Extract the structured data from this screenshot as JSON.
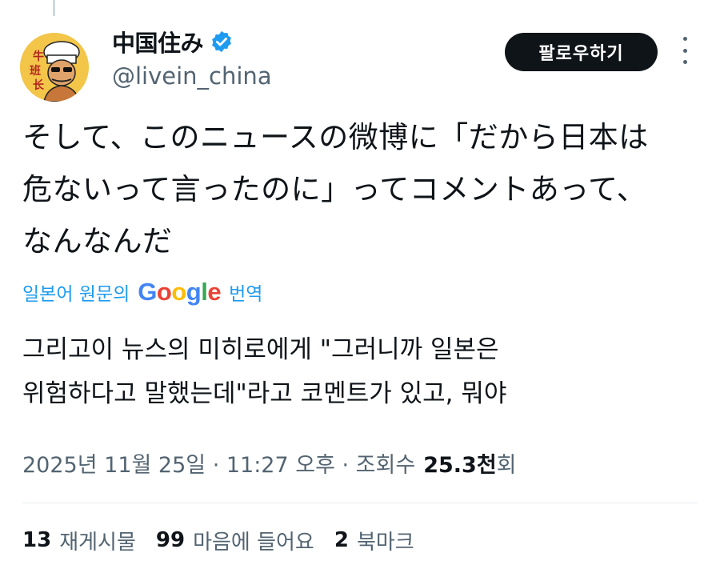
{
  "author": {
    "display_name": "中国住み",
    "handle": "@livein_china",
    "verified": true,
    "avatar_text": "牛班长"
  },
  "follow_label": "팔로우하기",
  "tweet_text": "そして、このニュースの微博に「だから日本は\n危ないって言ったのに」ってコメントあって、\nなんなんだ",
  "translation": {
    "label_prefix": "일본어 원문의",
    "label_suffix": "번역",
    "provider": "Google",
    "text": "그리고이 뉴스의 미히로에게 \"그러니까 일본은\n위험하다고 말했는데\"라고 코멘트가 있고, 뭐야"
  },
  "meta": {
    "timestamp": "2025년 11월 25일 · 11:27 오후 · 조회수",
    "views": "25.3천",
    "views_suffix": "회"
  },
  "stats": {
    "reposts": {
      "count": "13",
      "label": "재게시물"
    },
    "likes": {
      "count": "99",
      "label": "마음에 들어요"
    },
    "bookmarks": {
      "count": "2",
      "label": "북마크"
    }
  },
  "colors": {
    "accent": "#1d9bf0",
    "text_primary": "#0f1419",
    "text_secondary": "#536471",
    "button_bg": "#0f1419"
  }
}
